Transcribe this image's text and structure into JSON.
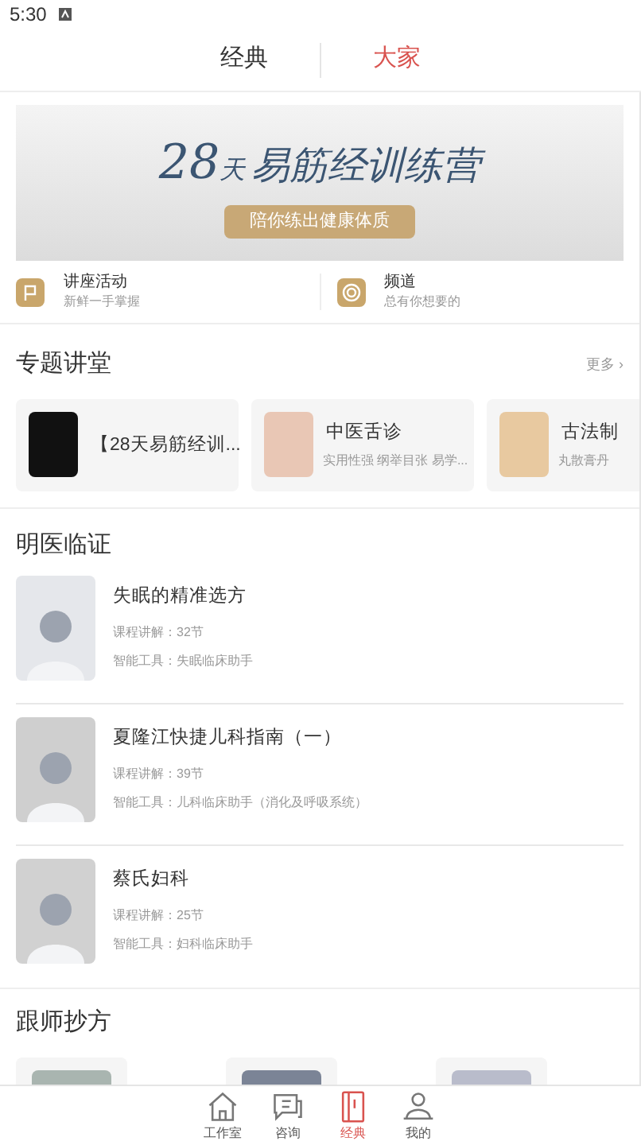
{
  "status_bar": {
    "time": "5:30"
  },
  "top_tabs": [
    {
      "label": "经典",
      "selected": false
    },
    {
      "label": "大家",
      "selected": true
    }
  ],
  "banner": {
    "title_number": "28",
    "title_day": "天",
    "title_main": "易筋经训练营",
    "subtitle": "陪你练出健康体质"
  },
  "quick_links": [
    {
      "kind": "flag",
      "title": "讲座活动",
      "subtitle": "新鲜一手掌握"
    },
    {
      "kind": "channel",
      "title": "频道",
      "subtitle": "总有你想要的"
    }
  ],
  "lectures": {
    "title": "专题讲堂",
    "more": "更多 ›",
    "items": [
      {
        "title": "【28天易筋经训..."
      },
      {
        "title": "中医舌诊",
        "subtitle": "实用性强 纲举目张 易学..."
      },
      {
        "title": "古法制",
        "subtitle": "丸散膏丹"
      }
    ]
  },
  "doctors": {
    "title": "明医临证",
    "items": [
      {
        "title": "失眠的精准选方",
        "lessons": "课程讲解：32节",
        "tool": "智能工具：失眠临床助手"
      },
      {
        "title": "夏隆江快捷儿科指南（一）",
        "lessons": "课程讲解：39节",
        "tool": "智能工具：儿科临床助手（消化及呼吸系统）"
      },
      {
        "title": "蔡氏妇科",
        "lessons": "课程讲解：25节",
        "tool": "智能工具：妇科临床助手"
      }
    ]
  },
  "follow": {
    "title": "跟师抄方"
  },
  "bottom_nav": [
    {
      "kind": "home",
      "label": "工作室",
      "selected": false
    },
    {
      "kind": "chat",
      "label": "咨询",
      "selected": false
    },
    {
      "kind": "book",
      "label": "经典",
      "selected": true
    },
    {
      "kind": "user",
      "label": "我的",
      "selected": false
    }
  ]
}
